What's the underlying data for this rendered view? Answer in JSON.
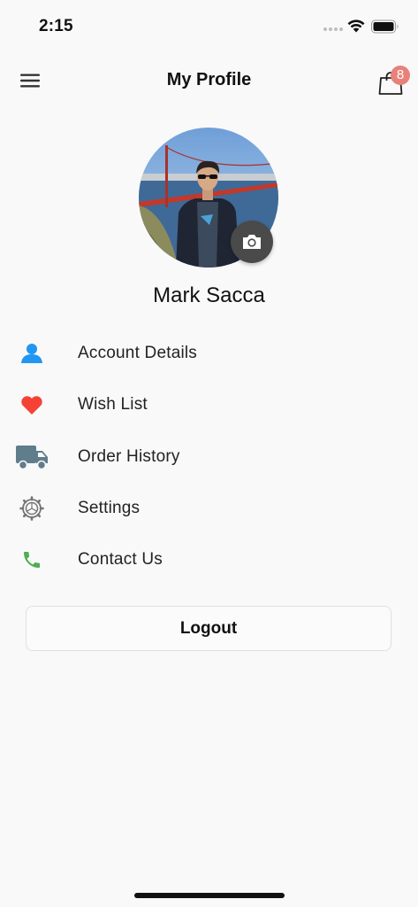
{
  "status_bar": {
    "time": "2:15"
  },
  "header": {
    "title": "My Profile",
    "cart_count": "8"
  },
  "profile": {
    "name": "Mark Sacca"
  },
  "menu": {
    "items": [
      {
        "label": "Account Details",
        "icon": "person-icon",
        "color": "#2196f3"
      },
      {
        "label": "Wish List",
        "icon": "heart-icon",
        "color": "#f44336"
      },
      {
        "label": "Order History",
        "icon": "truck-icon",
        "color": "#607d8b"
      },
      {
        "label": "Settings",
        "icon": "gear-icon",
        "color": "#757575"
      },
      {
        "label": "Contact Us",
        "icon": "phone-icon",
        "color": "#4caf50"
      }
    ]
  },
  "logout": {
    "label": "Logout"
  },
  "colors": {
    "badge": "#e8817a",
    "camera_button": "#4a4a4a",
    "background": "#f9f9f9"
  }
}
